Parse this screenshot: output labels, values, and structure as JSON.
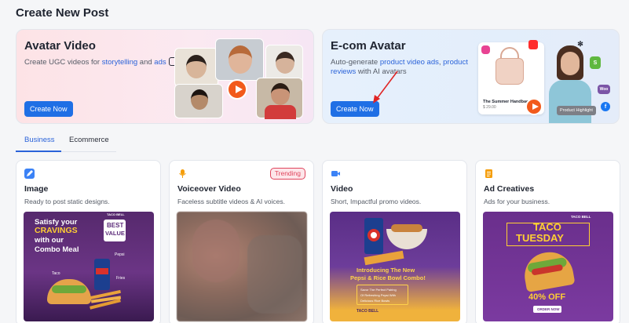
{
  "page": {
    "title": "Create New Post"
  },
  "hero": {
    "avatar": {
      "title": "Avatar Video",
      "desc_prefix": "Create UGC videos for ",
      "desc_link1": "storytelling",
      "desc_mid": " and ",
      "desc_link2": "ads",
      "button": "Create Now"
    },
    "ecom": {
      "title": "E-com Avatar",
      "desc_prefix": "Auto-generate ",
      "desc_link1": "product video ads",
      "desc_mid": ", ",
      "desc_link2": "product",
      "desc_link3": "reviews",
      "desc_suffix": " with AI avatars",
      "button": "Create Now",
      "card_label": "The Summer Handbag",
      "card_price": "$ 29.00",
      "tag": "Product Highlight"
    }
  },
  "tabs": [
    {
      "label": "Business",
      "active": true
    },
    {
      "label": "Ecommerce",
      "active": false
    }
  ],
  "cards": [
    {
      "title": "Image",
      "desc": "Ready to post static designs.",
      "icon": "edit-icon",
      "icon_color": "#3b82f6",
      "thumb": {
        "line1": "Satisfy your",
        "line2": "CRAVINGS",
        "line3": "with our",
        "line4": "Combo Meal",
        "badge1": "BEST",
        "badge2": "VALUE",
        "brand": "TACO BELL",
        "l1": "Pepsi",
        "l2": "Taco",
        "l3": "Fries"
      }
    },
    {
      "title": "Voiceover Video",
      "desc": "Faceless subtitle videos & AI voices.",
      "icon": "microphone-icon",
      "icon_color": "#f59e0b",
      "badge": "Trending"
    },
    {
      "title": "Video",
      "desc": "Short, Impactful promo videos.",
      "icon": "video-camera-icon",
      "icon_color": "#3b82f6",
      "thumb": {
        "line1": "Introducing The New",
        "line2": "Pepsi & Rice Bowl Combo!",
        "sub1": "Savor The Perfect Pairing",
        "sub2": "Of Refreshing Pepsi With",
        "sub3": "Delicious Rice Bowls",
        "brand": "TACO BELL"
      }
    },
    {
      "title": "Ad Creatives",
      "desc": "Ads for your business.",
      "icon": "document-icon",
      "icon_color": "#f59e0b",
      "thumb": {
        "brand": "TACO BELL",
        "line1": "TACO",
        "line2": "TUESDAY",
        "offer": "40% OFF",
        "cta": "ORDER NOW"
      }
    }
  ]
}
